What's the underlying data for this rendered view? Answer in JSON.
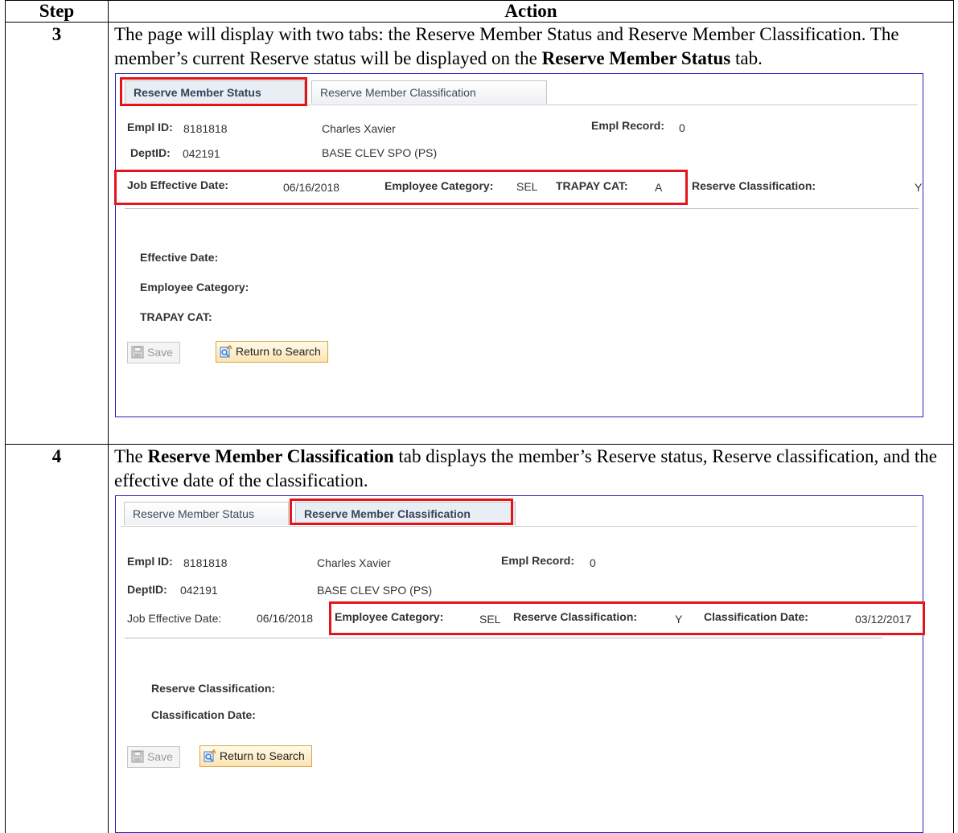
{
  "table": {
    "header_step": "Step",
    "header_action": "Action"
  },
  "steps": [
    {
      "number": "3",
      "text_parts": [
        "The page will display with two tabs:  the Reserve Member Status and Reserve Member Classification.  The member’s current Reserve status will be displayed on the ",
        "Reserve Member Status",
        " tab."
      ],
      "screen": {
        "tabs": [
          "Reserve Member Status",
          "Reserve Member Classification"
        ],
        "active_tab": 0,
        "empl_id_label": "Empl ID:",
        "empl_id": "8181818",
        "name": "Charles Xavier",
        "empl_record_label": "Empl Record:",
        "empl_record": "0",
        "deptid_label": "DeptID:",
        "deptid": "042191",
        "dept_name": "BASE CLEV SPO (PS)",
        "job_eff_label": "Job Effective Date:",
        "job_eff_date": "06/16/2018",
        "emp_cat_label": "Employee Category:",
        "emp_cat": "SEL",
        "trapay_label": "TRAPAY CAT:",
        "trapay": "A",
        "res_class_label": "Reserve Classification:",
        "res_class": "Y",
        "section_labels": [
          "Effective Date:",
          "Employee Category:",
          "TRAPAY CAT:"
        ],
        "save_label": "Save",
        "return_label": "Return to Search"
      }
    },
    {
      "number": "4",
      "text_parts": [
        "The ",
        "Reserve Member Classification",
        " tab displays the member’s Reserve status, Reserve classification, and the effective date of the classification."
      ],
      "screen": {
        "tabs": [
          "Reserve Member Status",
          "Reserve Member Classification"
        ],
        "active_tab": 1,
        "empl_id_label": "Empl ID:",
        "empl_id": "8181818",
        "name": "Charles Xavier",
        "empl_record_label": "Empl Record:",
        "empl_record": "0",
        "deptid_label": "DeptID:",
        "deptid": "042191",
        "dept_name": "BASE CLEV SPO (PS)",
        "job_eff_label": "Job Effective Date:",
        "job_eff_date": "06/16/2018",
        "emp_cat_label": "Employee Category:",
        "emp_cat": "SEL",
        "res_class_label": "Reserve Classification:",
        "res_class": "Y",
        "class_date_label": "Classification Date:",
        "class_date": "03/12/2017",
        "section_labels": [
          "Reserve Classification:",
          "Classification Date:"
        ],
        "save_label": "Save",
        "return_label": "Return to Search"
      }
    }
  ],
  "colors": {
    "highlight": "#e3151a",
    "pane_border": "#2323b8"
  },
  "icons": {
    "save": "save-icon",
    "return": "return-to-search-icon"
  }
}
